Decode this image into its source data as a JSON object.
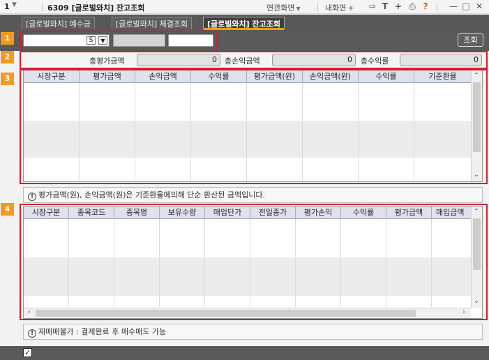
{
  "titlebar": {
    "num": "1",
    "title": "6309 [글로벌와치] 잔고조회",
    "related_label": "연관화면",
    "my_screen_label": "내화면",
    "help_mark": "?"
  },
  "tabs": [
    {
      "label": "[글로벌와치] 예수금"
    },
    {
      "label": "[글로벌와치] 체결조회"
    },
    {
      "label": "[글로벌와치] 잔고조회"
    }
  ],
  "toolbar": {
    "combo_badge": "S",
    "query_label": "조회"
  },
  "badges": [
    "1",
    "2",
    "3",
    "4"
  ],
  "summary": {
    "eval_label": "총평가금액",
    "eval_value": "0",
    "pnl_label": "총손익금액",
    "pnl_value": "0",
    "rate_label": "총수익률",
    "rate_value": "0"
  },
  "grid1": {
    "columns": [
      "시장구분",
      "평가금액",
      "손익금액",
      "수익률",
      "평가금액(원)",
      "손익금액(원)",
      "수익률",
      "기준환율"
    ]
  },
  "notice1": "평가금액(원), 손익금액(원)은 기준환율에의해 단순 환산된 금액입니다.",
  "grid2": {
    "columns": [
      "시장구분",
      "종목코드",
      "종목명",
      "보유수량",
      "매입단가",
      "전일종가",
      "평가손익",
      "수익률",
      "평가금액",
      "매입금액"
    ]
  },
  "notice2": "재매매불가 : 결제완료 후 매수매도 가능",
  "colors": {
    "highlight": "#cf2030",
    "badge": "#f49a1c",
    "active_tab_underline": "#f3a000"
  }
}
